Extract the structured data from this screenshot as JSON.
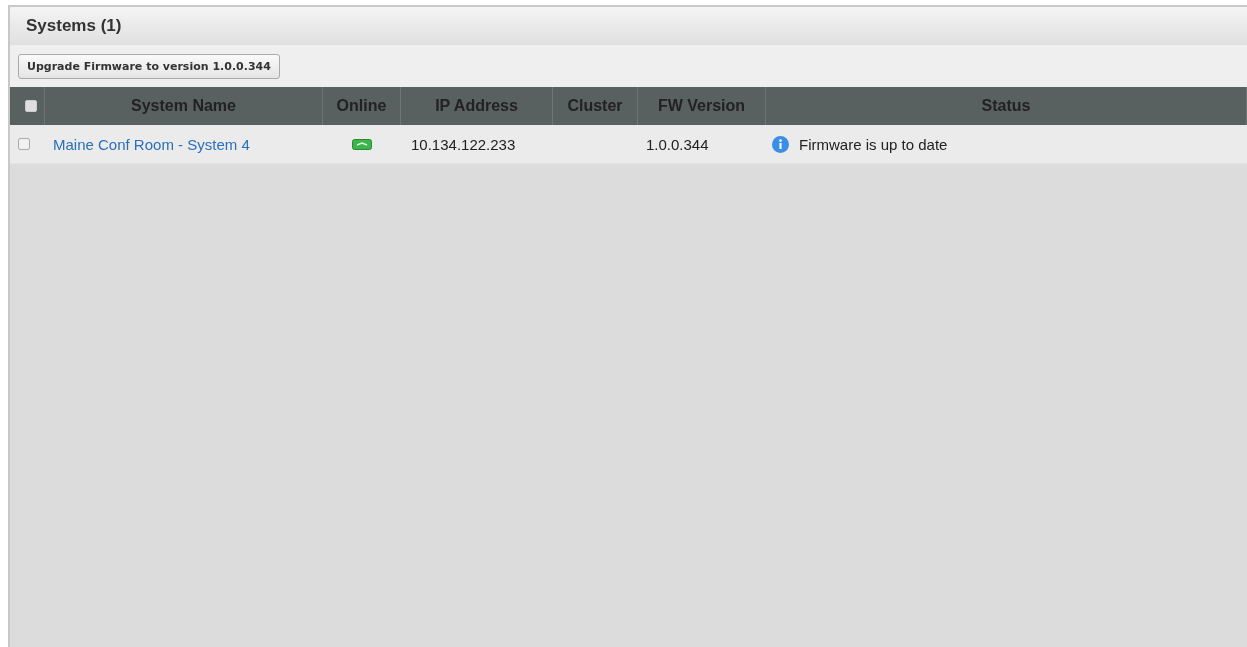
{
  "panel": {
    "title": "Systems (1)"
  },
  "toolbar": {
    "buttons": [
      "Upgrade Firmware to version 1.0.0.344"
    ]
  },
  "table": {
    "select_all": {
      "checked": false
    },
    "columns": [
      "System Name",
      "Online",
      "IP Address",
      "Cluster",
      "FW Version",
      "Status"
    ],
    "rows": [
      {
        "checked": false,
        "name": "Maine Conf Room - System 4",
        "online": true,
        "ip": "10.134.122.233",
        "fw_version": "1.0.0.344",
        "status": {
          "kind": "info",
          "text": "Firmware is up to date"
        }
      }
    ]
  }
}
